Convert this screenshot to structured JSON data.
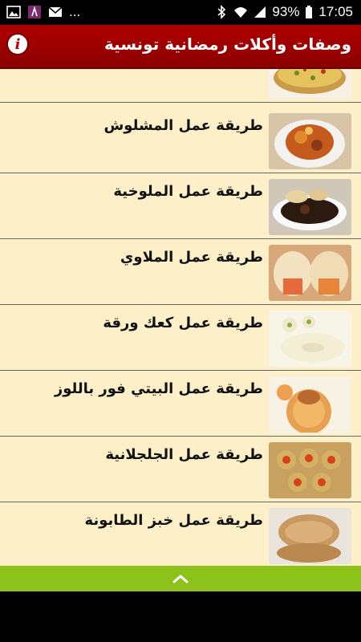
{
  "status_bar": {
    "dots": "...",
    "battery_percent": "93%",
    "time": "17:05",
    "left_icons": [
      "image-icon",
      "app-icon",
      "mail-icon"
    ],
    "right_icons": [
      "bluetooth-icon",
      "wifi-icon",
      "signal-icon",
      "battery-icon"
    ]
  },
  "app_bar": {
    "title": "وصفات وأكلات رمضانية تونسية",
    "info_label": "i",
    "color": "#a00000"
  },
  "recipes": [
    {
      "label": ""
    },
    {
      "label": "طريقة عمل المشلوش"
    },
    {
      "label": "طريقة عمل الملوخية"
    },
    {
      "label": "طريقة عمل الملاوي"
    },
    {
      "label": "طريقة عمل كعك ورقة"
    },
    {
      "label": "طريقة عمل البيتي فور باللوز"
    },
    {
      "label": "طريقة عمل الجلجلانية"
    },
    {
      "label": "طريقة عمل خبز الطابونة"
    }
  ],
  "bottom_bar": {
    "icon": "chevron-up-icon",
    "color": "#8cc21a"
  }
}
